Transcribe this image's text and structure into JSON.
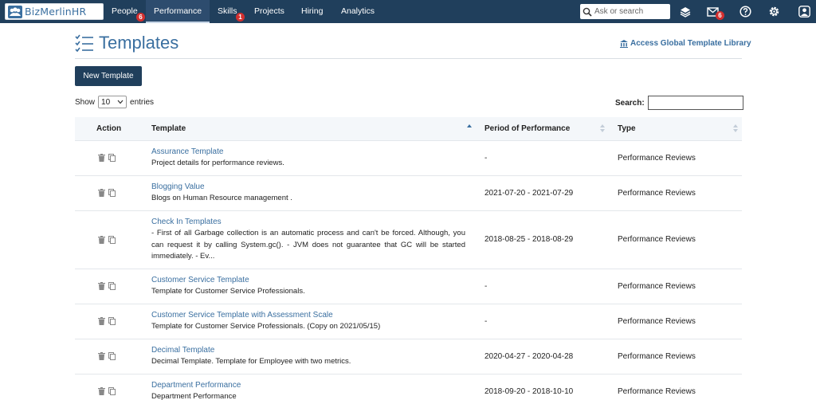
{
  "nav": {
    "logo_text": "BizMerlinHR",
    "items": [
      {
        "label": "People",
        "badge": "6"
      },
      {
        "label": "Performance",
        "badge": ""
      },
      {
        "label": "Skills",
        "badge": "1"
      },
      {
        "label": "Projects",
        "badge": ""
      },
      {
        "label": "Hiring",
        "badge": ""
      },
      {
        "label": "Analytics",
        "badge": ""
      }
    ],
    "search_placeholder": "Ask or search",
    "mail_badge": "6",
    "icons": [
      "layers-icon",
      "mail-icon",
      "help-icon",
      "settings-icon",
      "user-icon"
    ]
  },
  "page": {
    "title": "Templates",
    "global_link": "Access Global Template Library",
    "new_button": "New Template",
    "show_label": "Show",
    "show_value": "10",
    "entries_label": "entries",
    "search_label": "Search:"
  },
  "table": {
    "headers": {
      "action": "Action",
      "template": "Template",
      "period": "Period of Performance",
      "type": "Type"
    },
    "rows": [
      {
        "name": "Assurance Template",
        "desc": "Project details for performance reviews.",
        "period": "-",
        "type": "Performance Reviews"
      },
      {
        "name": "Blogging Value",
        "desc": "Blogs on Human Resource management .",
        "period": "2021-07-20 - 2021-07-29",
        "type": "Performance Reviews"
      },
      {
        "name": "Check In Templates",
        "desc": "- First of all Garbage collection is an automatic process and can't be forced. Although, you can request it by calling System.gc(). - JVM does not guarantee that GC will be started immediately. - Ev...",
        "period": "2018-08-25 - 2018-08-29",
        "type": "Performance Reviews"
      },
      {
        "name": "Customer Service Template",
        "desc": "Template for Customer Service Professionals.",
        "period": "-",
        "type": "Performance Reviews"
      },
      {
        "name": "Customer Service Template with Assessment Scale",
        "desc": "Template for Customer Service Professionals. (Copy on 2021/05/15)",
        "period": "-",
        "type": "Performance Reviews"
      },
      {
        "name": "Decimal Template",
        "desc": "Decimal Template. Template for Employee with two metrics.",
        "period": "2020-04-27 - 2020-04-28",
        "type": "Performance Reviews"
      },
      {
        "name": "Department Performance",
        "desc": "Department Performance",
        "period": "2018-09-20 - 2018-10-10",
        "type": "Performance Reviews"
      }
    ]
  },
  "colors": {
    "nav_bg": "#203f5c",
    "accent": "#3a6fa0",
    "badge": "#d32f2f"
  }
}
